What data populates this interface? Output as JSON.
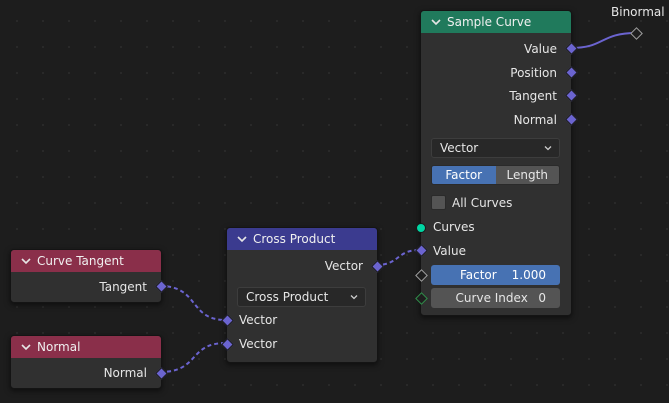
{
  "colors": {
    "canvas": "#1d1d1d",
    "sample_curve_header": "#207a5c",
    "cross_product_header": "#3b3b8f",
    "input_node_header": "#8a2f4a",
    "vector_socket": "#6b64d0",
    "geometry_socket": "#00d6a3",
    "active_blue": "#4772b3"
  },
  "floating_label": "Binormal",
  "sample_curve": {
    "title": "Sample Curve",
    "outputs": [
      "Value",
      "Position",
      "Tangent",
      "Normal"
    ],
    "data_type": "Vector",
    "mode_options": [
      "Factor",
      "Length"
    ],
    "mode_selected": "Factor",
    "all_curves_label": "All Curves",
    "all_curves_checked": false,
    "inputs": {
      "curves": "Curves",
      "value": "Value",
      "factor_label": "Factor",
      "factor_value": "1.000",
      "curve_index_label": "Curve Index",
      "curve_index_value": "0"
    }
  },
  "cross_product": {
    "title": "Cross Product",
    "output": "Vector",
    "operation": "Cross Product",
    "inputs": [
      "Vector",
      "Vector"
    ]
  },
  "curve_tangent": {
    "title": "Curve Tangent",
    "output": "Tangent"
  },
  "normal": {
    "title": "Normal",
    "output": "Normal"
  }
}
